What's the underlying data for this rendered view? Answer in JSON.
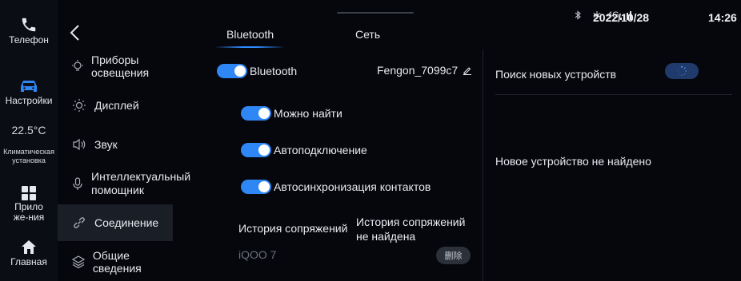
{
  "rail": {
    "phone": "Телефон",
    "settings": "Настройки",
    "temperature": "22.5°C",
    "climate": "Климатическая установка",
    "apps": "Приложе-ния",
    "home": "Главная"
  },
  "menu": {
    "items": [
      {
        "label": "Приборы освещения",
        "icon": "light-bulb-icon"
      },
      {
        "label": "Дисплей",
        "icon": "sun-icon"
      },
      {
        "label": "Звук",
        "icon": "speaker-icon"
      },
      {
        "label": "Интеллектуальный помощник",
        "icon": "microphone-icon"
      },
      {
        "label": "Соединение",
        "icon": "link-icon",
        "active": true
      },
      {
        "label": "Общие сведения",
        "icon": "layers-icon"
      }
    ]
  },
  "tabs": {
    "bluetooth": "Bluetooth",
    "network": "Сеть"
  },
  "bluetooth": {
    "main_label": "Bluetooth",
    "device_name": "Fengon_7099c7",
    "discoverable": "Можно найти",
    "autoconnect": "Автоподключение",
    "autosync": "Автосинхронизация контактов"
  },
  "history": {
    "title": "История сопряжений",
    "none": "История сопряжений не найдена",
    "device": "iQOO 7",
    "delete": "删除"
  },
  "search": {
    "label": "Поиск новых устройств",
    "none_found": "Новое устройство не найдено"
  },
  "status": {
    "network": "4G",
    "date": "2022/10/28",
    "time": "14:26"
  },
  "colors": {
    "accent": "#2f86f5",
    "background": "#05070c",
    "active_menu": "#1a1e27"
  }
}
